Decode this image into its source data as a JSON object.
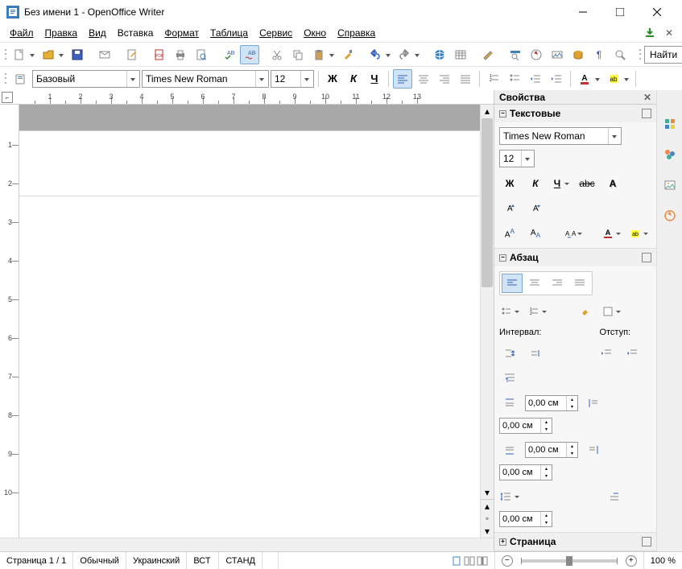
{
  "title": "Без имени 1 - OpenOffice Writer",
  "menu": [
    "Файл",
    "Правка",
    "Вид",
    "Вставка",
    "Формат",
    "Таблица",
    "Сервис",
    "Окно",
    "Справка"
  ],
  "find_label": "Найти",
  "format_toolbar": {
    "style": "Базовый",
    "font": "Times New Roman",
    "size": "12",
    "bold": "Ж",
    "italic": "К",
    "underline": "Ч"
  },
  "sidebar": {
    "title": "Свойства",
    "text_section": "Текстовые",
    "para_section": "Абзац",
    "page_section": "Страница",
    "font": "Times New Roman",
    "size": "12",
    "bold": "Ж",
    "italic": "К",
    "underline": "Ч",
    "interval_label": "Интервал:",
    "indent_label": "Отступ:",
    "spacing_above": "0,00 см",
    "spacing_below": "0,00 см",
    "indent_left": "0,00 см",
    "indent_right": "0,00 см",
    "indent_first": "0,00 см"
  },
  "status": {
    "page": "Страница  1 / 1",
    "style": "Обычный",
    "lang": "Украинский",
    "ins": "ВСТ",
    "sel": "СТАНД",
    "zoom": "100 %"
  },
  "ruler_h": [
    "1",
    "2",
    "3",
    "4",
    "5",
    "6",
    "7",
    "8",
    "9",
    "10",
    "11",
    "12",
    "13"
  ],
  "ruler_v": [
    "1",
    "2",
    "3",
    "4",
    "5",
    "6",
    "7",
    "8",
    "9",
    "10"
  ]
}
